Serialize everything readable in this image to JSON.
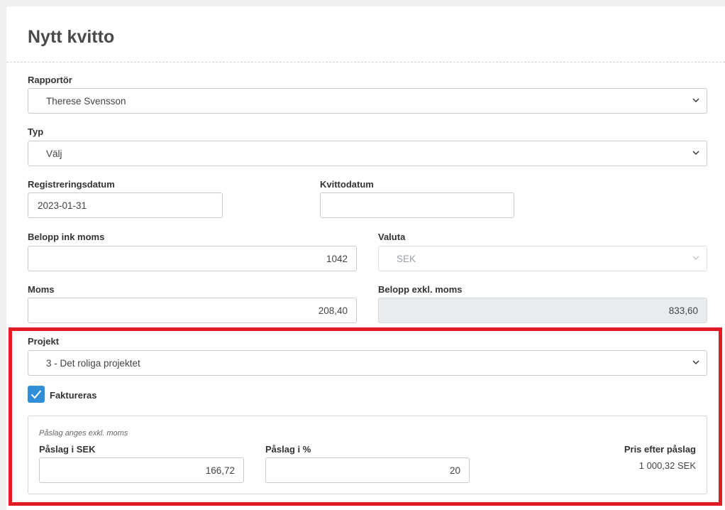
{
  "page": {
    "title": "Nytt kvitto"
  },
  "reporter": {
    "label": "Rapportör",
    "value": "Therese Svensson"
  },
  "type": {
    "label": "Typ",
    "value": "Välj"
  },
  "registration_date": {
    "label": "Registreringsdatum",
    "value": "2023-01-31"
  },
  "receipt_date": {
    "label": "Kvittodatum",
    "value": ""
  },
  "amount_incl_vat": {
    "label": "Belopp ink moms",
    "value": "1042"
  },
  "currency": {
    "label": "Valuta",
    "value": "SEK"
  },
  "vat": {
    "label": "Moms",
    "value": "208,40"
  },
  "amount_excl_vat": {
    "label": "Belopp exkl. moms",
    "value": "833,60"
  },
  "project": {
    "label": "Projekt",
    "value": "3 - Det roliga projektet"
  },
  "invoiced": {
    "label": "Faktureras",
    "checked": true
  },
  "markup": {
    "note": "Påslag anges exkl. moms",
    "sek_label": "Påslag i SEK",
    "sek_value": "166,72",
    "percent_label": "Påslag i %",
    "percent_value": "20",
    "price_label": "Pris efter påslag",
    "price_value": "1 000,32 SEK"
  },
  "icons": {
    "chevron": "chevron-down-icon",
    "check": "checkmark-icon"
  },
  "colors": {
    "highlight": "#e01b24",
    "checkbox": "#2f8fd8"
  }
}
